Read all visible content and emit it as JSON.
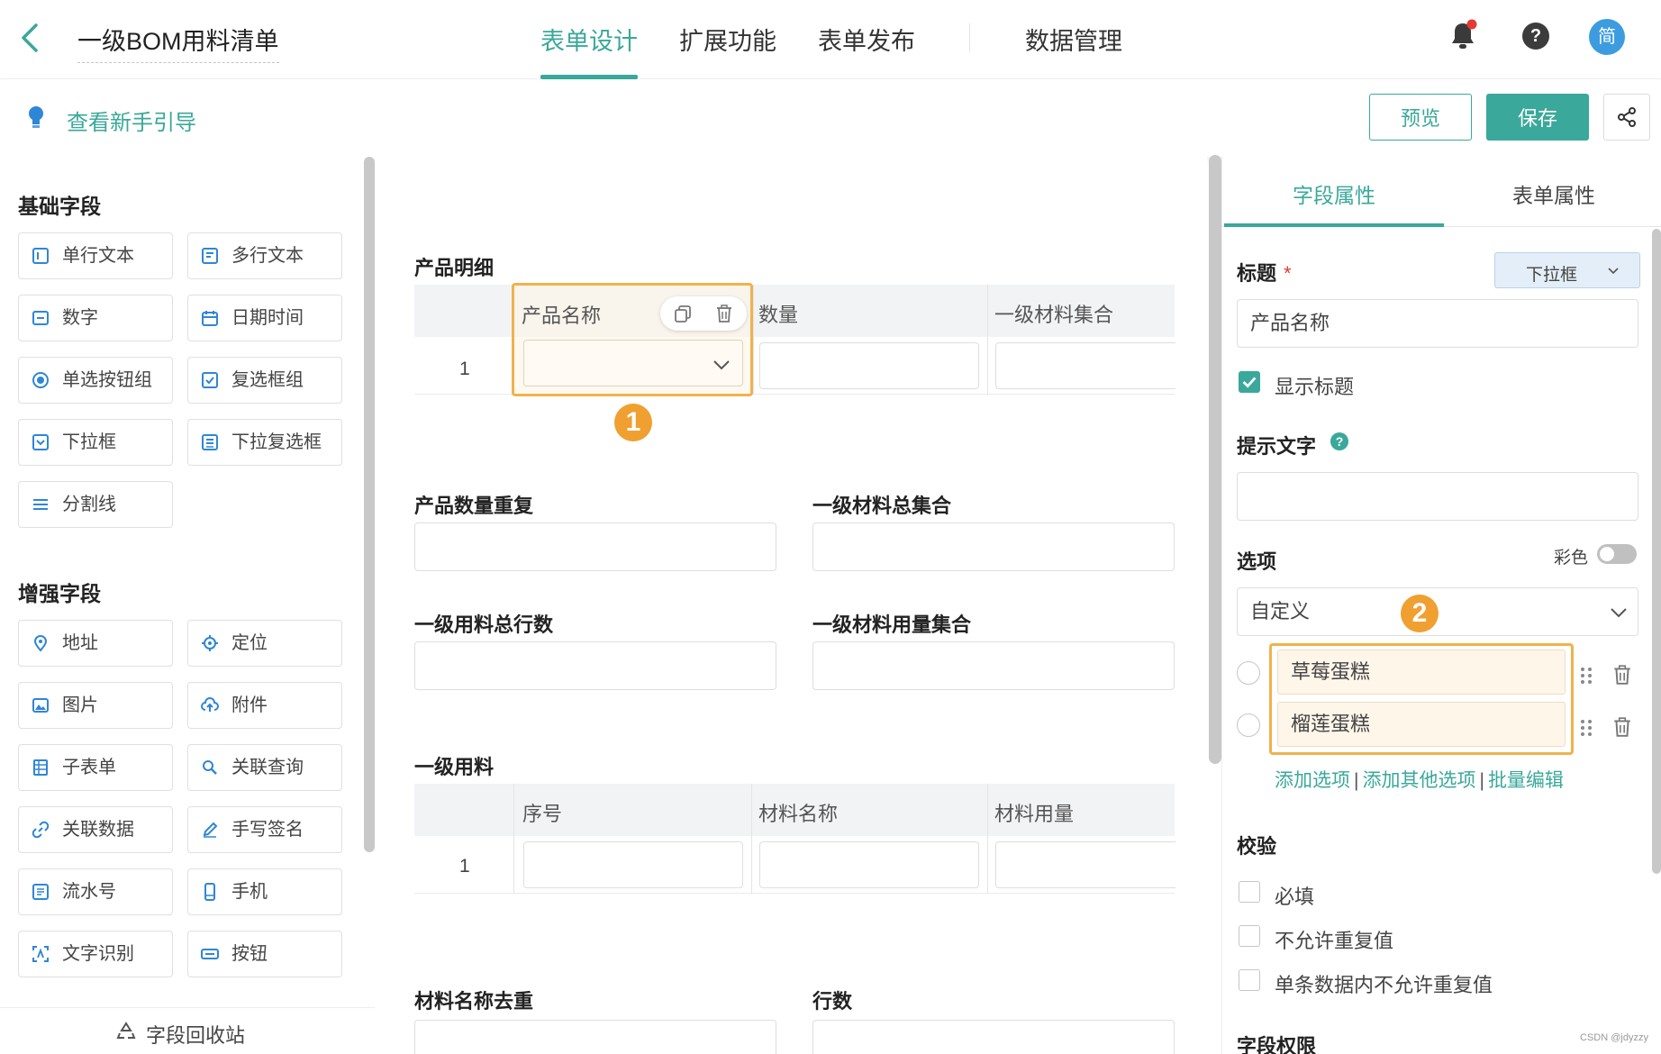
{
  "header": {
    "title": "一级BOM用料清单",
    "tabs": [
      {
        "label": "表单设计",
        "active": true
      },
      {
        "label": "扩展功能",
        "active": false
      },
      {
        "label": "表单发布",
        "active": false
      },
      {
        "label": "数据管理",
        "active": false
      }
    ],
    "avatar_text": "简",
    "help_text": "?",
    "notification_dot": true
  },
  "toolbar": {
    "guide_link": "查看新手引导",
    "preview_label": "预览",
    "save_label": "保存"
  },
  "left_panel": {
    "basic_title": "基础字段",
    "basic_fields": [
      {
        "label": "单行文本",
        "icon": "single-line-text-icon"
      },
      {
        "label": "多行文本",
        "icon": "multi-line-text-icon"
      },
      {
        "label": "数字",
        "icon": "number-icon"
      },
      {
        "label": "日期时间",
        "icon": "calendar-icon"
      },
      {
        "label": "单选按钮组",
        "icon": "radio-icon"
      },
      {
        "label": "复选框组",
        "icon": "checkbox-icon"
      },
      {
        "label": "下拉框",
        "icon": "dropdown-icon"
      },
      {
        "label": "下拉复选框",
        "icon": "dropdown-checkbox-icon"
      },
      {
        "label": "分割线",
        "icon": "divider-icon"
      }
    ],
    "enhanced_title": "增强字段",
    "enhanced_fields": [
      {
        "label": "地址",
        "icon": "location-pin-icon"
      },
      {
        "label": "定位",
        "icon": "crosshair-icon"
      },
      {
        "label": "图片",
        "icon": "image-icon"
      },
      {
        "label": "附件",
        "icon": "upload-cloud-icon"
      },
      {
        "label": "子表单",
        "icon": "subform-icon"
      },
      {
        "label": "关联查询",
        "icon": "link-search-icon"
      },
      {
        "label": "关联数据",
        "icon": "link-data-icon"
      },
      {
        "label": "手写签名",
        "icon": "pen-icon"
      },
      {
        "label": "流水号",
        "icon": "serial-number-icon"
      },
      {
        "label": "手机",
        "icon": "phone-icon"
      },
      {
        "label": "文字识别",
        "icon": "ocr-icon"
      },
      {
        "label": "按钮",
        "icon": "button-icon"
      }
    ],
    "recycle_label": "字段回收站"
  },
  "canvas": {
    "product_detail": {
      "label": "产品明细",
      "columns": [
        "产品名称",
        "数量",
        "一级材料集合"
      ],
      "row_no": "1"
    },
    "badge1": "1",
    "field_rows": [
      {
        "left": "产品数量重复",
        "right": "一级材料总集合"
      },
      {
        "left": "一级用料总行数",
        "right": "一级材料用量集合"
      }
    ],
    "material": {
      "label": "一级用料",
      "columns": [
        "序号",
        "材料名称",
        "材料用量"
      ],
      "row_no": "1"
    },
    "bottom_row": {
      "left": "材料名称去重",
      "right": "行数"
    }
  },
  "right_panel": {
    "tabs": [
      {
        "label": "字段属性",
        "active": true
      },
      {
        "label": "表单属性",
        "active": false
      }
    ],
    "title_label": "标题",
    "required_mark": "*",
    "type_button": "下拉框",
    "title_value": "产品名称",
    "show_title_label": "显示标题",
    "show_title_checked": true,
    "hint_label": "提示文字",
    "options_label": "选项",
    "color_label": "彩色",
    "options_source": "自定义",
    "badge2": "2",
    "options": [
      "草莓蛋糕",
      "榴莲蛋糕"
    ],
    "links": [
      "添加选项",
      "添加其他选项",
      "批量编辑"
    ],
    "validation_label": "校验",
    "validations": [
      {
        "label": "必填",
        "checked": false
      },
      {
        "label": "不允许重复值",
        "checked": false
      },
      {
        "label": "单条数据内不允许重复值",
        "checked": false
      }
    ],
    "permission_label": "字段权限"
  },
  "watermark": "CSDN @jdyzzy",
  "colors": {
    "accent": "#3aa89a",
    "highlight": "#f0b24d",
    "badge": "#f0a030",
    "avatar": "#3d9ce0",
    "notify": "#e53935"
  }
}
